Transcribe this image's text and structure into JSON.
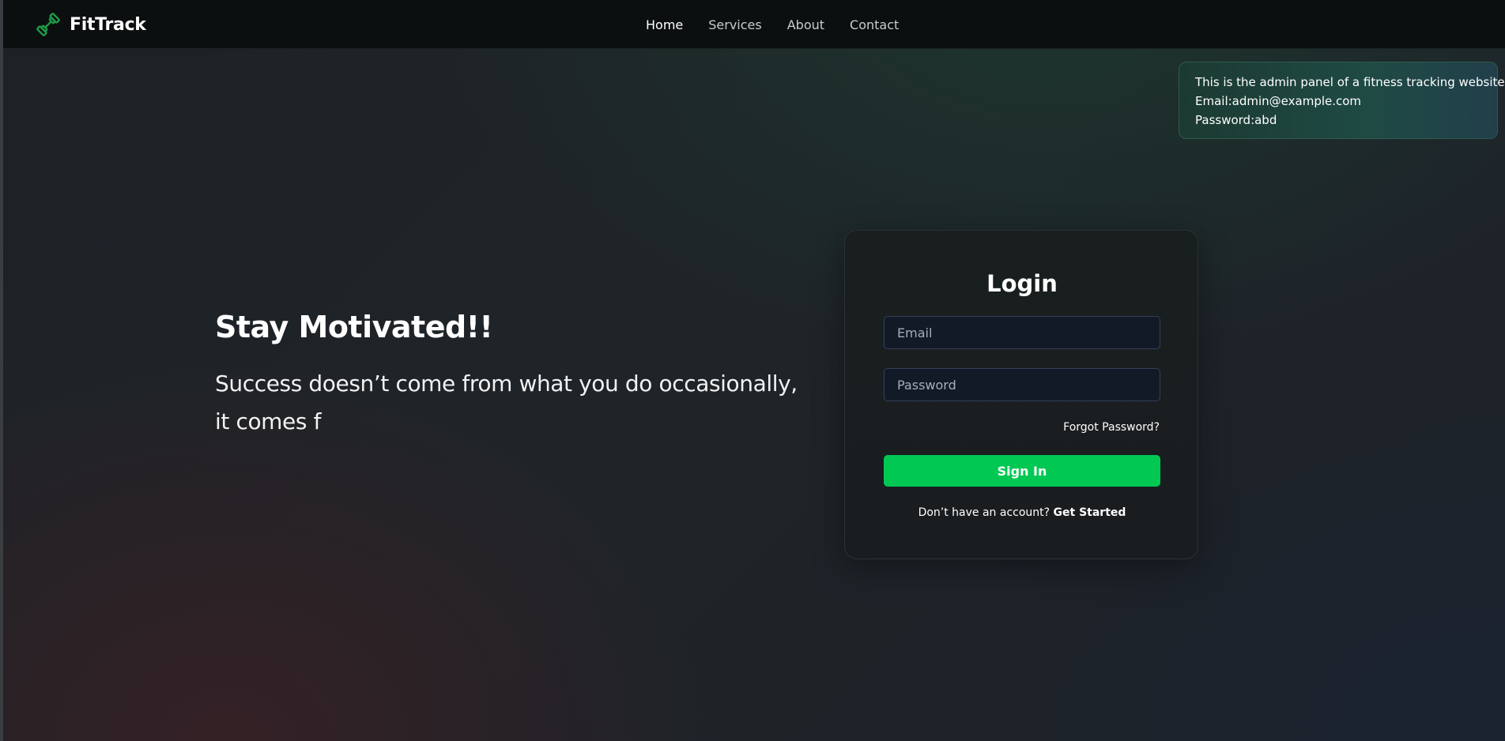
{
  "navbar": {
    "brand": "FitTrack",
    "brand_icon": "dumbbell-icon",
    "accent_color": "#00c853",
    "links": [
      {
        "label": "Home",
        "active": true
      },
      {
        "label": "Services",
        "active": false
      },
      {
        "label": "About",
        "active": false
      },
      {
        "label": "Contact",
        "active": false
      }
    ]
  },
  "admin_note": {
    "line1": "This is the admin panel of a fitness tracking website",
    "line2": "Email:admin@example.com",
    "line3": "Password:abd"
  },
  "hero": {
    "title": "Stay Motivated!!",
    "text": "Success doesn’t come from what you do occasionally, it comes f"
  },
  "login": {
    "title": "Login",
    "email_placeholder": "Email",
    "email_value": "",
    "password_placeholder": "Password",
    "password_value": "",
    "forgot_label": "Forgot Password?",
    "signin_label": "Sign In",
    "signin_color": "#00c853",
    "no_account_text": "Don’t have an account?",
    "get_started_label": "Get Started"
  }
}
